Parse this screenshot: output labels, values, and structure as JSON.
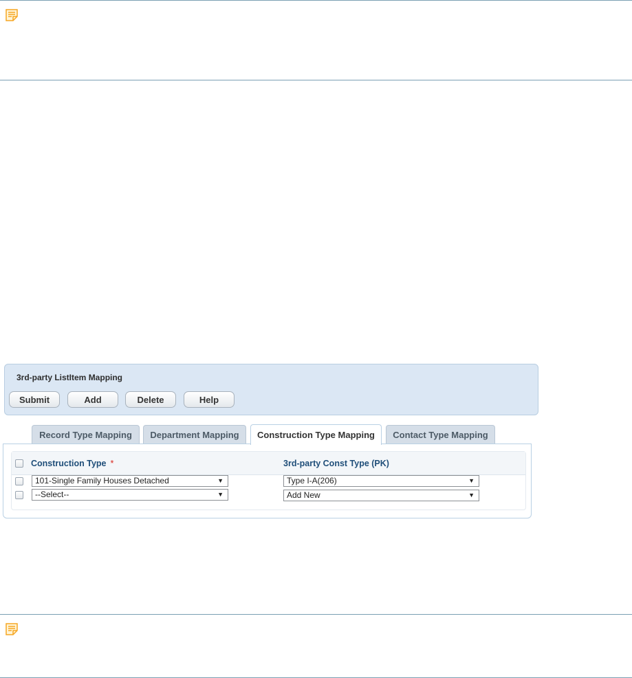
{
  "panel": {
    "title": "3rd-party ListItem Mapping",
    "buttons": {
      "submit": "Submit",
      "add": "Add",
      "delete": "Delete",
      "help": "Help"
    }
  },
  "tabs": [
    {
      "label": "Record Type Mapping",
      "active": false
    },
    {
      "label": "Department Mapping",
      "active": false
    },
    {
      "label": "Construction Type Mapping",
      "active": true
    },
    {
      "label": "Contact Type Mapping",
      "active": false
    }
  ],
  "grid": {
    "columns": {
      "construction_type": "Construction Type",
      "required_marker": "*",
      "third_party_type": "3rd-party Const Type (PK)"
    },
    "rows": [
      {
        "construction_type": "101-Single Family Houses Detached",
        "third_party_type": "Type I-A(206)"
      },
      {
        "construction_type": "--Select--",
        "third_party_type": "Add New"
      }
    ]
  },
  "icons": {
    "note": "note-icon",
    "dropdown": "chevron-down-icon"
  },
  "colors": {
    "note_icon": "#f5a623",
    "panel_bg": "#dbe7f4",
    "column_header": "#1f4e79",
    "required": "#d9261c"
  }
}
